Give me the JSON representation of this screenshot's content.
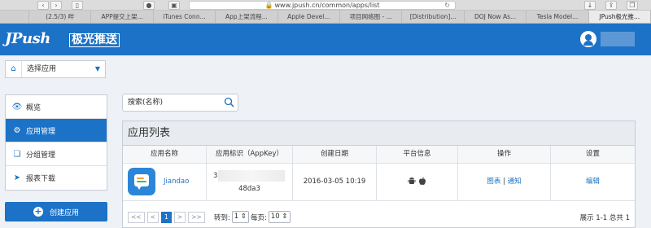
{
  "browser": {
    "url": "www.jpush.cn/common/apps/list",
    "tabs": [
      {
        "label": "(2.5/3) 哔"
      },
      {
        "label": "APP提交上架..."
      },
      {
        "label": "iTunes Conn..."
      },
      {
        "label": "App上架流程..."
      },
      {
        "label": "Apple Devel..."
      },
      {
        "label": "项目网络图 - ..."
      },
      {
        "label": "[Distribution]..."
      },
      {
        "label": "DOJ Now As..."
      },
      {
        "label": "Tesla Model..."
      },
      {
        "label": "JPush极光推..."
      }
    ]
  },
  "header": {
    "logo": "JPush",
    "logo_cn": "极光推送"
  },
  "app_select": {
    "label": "选择应用"
  },
  "sidebar": {
    "items": [
      {
        "label": "概览",
        "icon": "eye-icon"
      },
      {
        "label": "应用管理",
        "icon": "gear-icon"
      },
      {
        "label": "分组管理",
        "icon": "group-icon"
      },
      {
        "label": "报表下载",
        "icon": "send-icon"
      }
    ],
    "create_label": "创建应用"
  },
  "search": {
    "placeholder": "搜索(名称)"
  },
  "panel": {
    "title": "应用列表",
    "columns": [
      "应用名称",
      "应用标识（AppKey）",
      "创建日期",
      "平台信息",
      "操作",
      "设置"
    ],
    "rows": [
      {
        "name": "Jiandao",
        "appkey_start": "3a",
        "appkey_end": "48da3",
        "date": "2016-03-05 10:19",
        "platforms": "Android, iOS",
        "op_chart": "图表",
        "op_sep": "|",
        "op_notify": "通知",
        "setting": "编辑"
      }
    ]
  },
  "pager": {
    "first": "<<",
    "prev": "<",
    "current": "1",
    "next": ">",
    "last": ">>",
    "goto_label": "转到:",
    "goto_value": "1",
    "per_page_label": "每页:",
    "per_page_value": "10",
    "info": "展示 1-1 总共 1"
  },
  "colors": {
    "brand": "#1c72c6",
    "accent_orange": "#f2a33a"
  }
}
